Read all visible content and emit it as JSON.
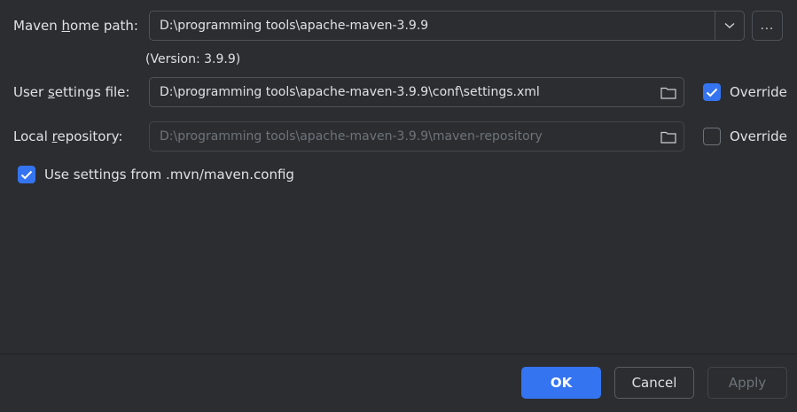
{
  "maven_home": {
    "label_pre": "Maven ",
    "label_mnemonic": "h",
    "label_post": "ome path:",
    "value": "D:\\programming tools\\apache-maven-3.9.9",
    "browse_label": "...",
    "version": "(Version: 3.9.9)"
  },
  "user_settings": {
    "label_pre": "User ",
    "label_mnemonic": "s",
    "label_post": "ettings file:",
    "value": "D:\\programming tools\\apache-maven-3.9.9\\conf\\settings.xml",
    "override_label": "Override",
    "override_checked": true
  },
  "local_repo": {
    "label_pre": "Local ",
    "label_mnemonic": "r",
    "label_post": "epository:",
    "value": "D:\\programming tools\\apache-maven-3.9.9\\maven-repository",
    "override_label": "Override",
    "override_checked": false
  },
  "mvn_config": {
    "label": "Use settings from .mvn/maven.config",
    "checked": true
  },
  "footer": {
    "ok_label": "OK",
    "cancel_label": "Cancel",
    "apply_label": "Apply"
  },
  "colors": {
    "background": "#2b2d30",
    "accent": "#3574f0",
    "text": "#dfe1e5",
    "disabled_text": "#6f737a"
  }
}
